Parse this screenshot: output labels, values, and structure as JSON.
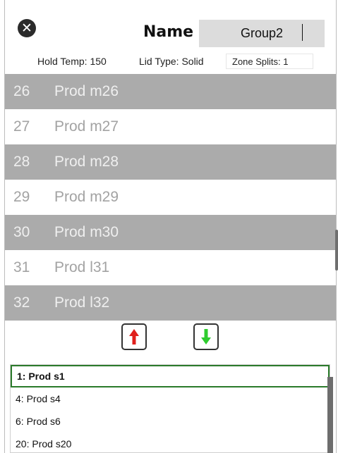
{
  "header": {
    "close_icon": "close-icon",
    "name_label": "Name",
    "name_value": "Group2"
  },
  "info": {
    "hold_temp": "Hold Temp: 150",
    "lid_type": "Lid Type: Solid",
    "zone_splits": "Zone Splits: 1"
  },
  "products": [
    {
      "num": "26",
      "name": "Prod m26"
    },
    {
      "num": "27",
      "name": "Prod m27"
    },
    {
      "num": "28",
      "name": "Prod m28"
    },
    {
      "num": "29",
      "name": "Prod m29"
    },
    {
      "num": "30",
      "name": "Prod m30"
    },
    {
      "num": "31",
      "name": "Prod l31"
    },
    {
      "num": "32",
      "name": "Prod l32"
    }
  ],
  "arrows": {
    "up_icon": "arrow-up-icon",
    "up_color": "#e0201c",
    "down_icon": "arrow-down-icon",
    "down_color": "#2ecc2e"
  },
  "group_items": [
    {
      "label": "1: Prod s1",
      "selected": true
    },
    {
      "label": "4: Prod s4",
      "selected": false
    },
    {
      "label": "6: Prod s6",
      "selected": false
    },
    {
      "label": "20: Prod s20",
      "selected": false
    }
  ],
  "colors": {
    "row_dark": "#ababab",
    "row_light": "#ffffff",
    "selected_border": "#2a7a2a"
  }
}
